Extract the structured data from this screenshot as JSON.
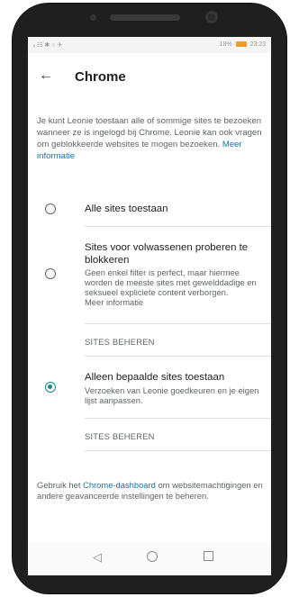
{
  "status_bar": {
    "left_icons": "ᵢᵢ ☷ ✱ ○ ✈",
    "battery_percent": "18%",
    "time": "23:23",
    "battery_color": "#f59a23"
  },
  "header": {
    "back_icon": "arrow-left-icon",
    "title": "Chrome"
  },
  "description": {
    "text": "Je kunt Leonie toestaan alle of sommige sites te bezoeken wanneer ze is ingelogd bij Chrome. Leonie kan ook vragen om geblokkeerde websites te mogen bezoeken. ",
    "link": "Meer informatie"
  },
  "options": [
    {
      "label": "Alle sites toestaan",
      "selected": false
    },
    {
      "label": "Sites voor volwassenen proberen te blokkeren",
      "description": "Geen enkel filter is perfect, maar hiermee worden de meeste sites met gewelddadige en seksueel expliciete content verborgen.",
      "link": "Meer informatie",
      "manage": "SITES BEHEREN",
      "selected": false
    },
    {
      "label": "Alleen bepaalde sites toestaan",
      "description": "Verzoeken van Leonie goedkeuren en je eigen lijst aanpassen.",
      "manage": "SITES BEHEREN",
      "selected": true
    }
  ],
  "footer": {
    "prefix": "Gebruik het ",
    "link": "Chrome-dashboard",
    "suffix": " om websitemachtigingen en andere geavanceerde instellingen te beheren."
  },
  "colors": {
    "accent": "#1a8a7a",
    "link": "#1a73a8"
  }
}
